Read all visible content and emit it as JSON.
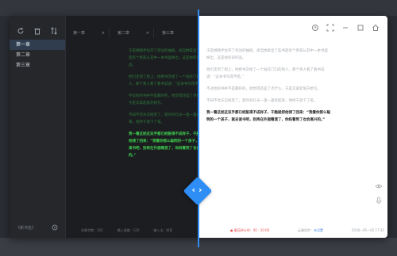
{
  "sidebar": {
    "chapters": [
      "第一章",
      "第二章",
      "第三章"
    ],
    "footer_label": "《新书名》",
    "icons": [
      "refresh-icon",
      "trash-icon",
      "sort-icon"
    ]
  },
  "dark": {
    "tabs": [
      "第一章",
      "第二章",
      "第三章"
    ],
    "paragraphs": [
      "于是她随手拉开了旁边的抽屉，再当她拿出了些书后有个男孩从其中一本书里掉出，这是他的旧作品。",
      "他们走到了街上，他把书交给了一个站在门口的男人，那个男人看了看书说道：“这本书写得不错。”",
      "不过他的书并不是最好的，他觉得还差了点什么，于是又拿起笔开始写。",
      "不知不觉天已经黑了，窗外的灯光一盏一盏亮起来，他终于放下了笔。"
    ],
    "highlight": "我一看这娃这双手都已经脏得不成样子，干脆就把他领了回来：“我看你那么聪明的一个孩子，就去读书吧，别再在外面瞎混了，你妈看到了也会高兴的。”",
    "status": [
      "本章字数：102",
      "输入速度：120",
      "输入法：拼音"
    ]
  },
  "light": {
    "paragraphs": [
      "于是她随手拉开了旁边的抽屉，再当她拿出了些书后有个男孩从其中一本书里掉出，这是他的旧作品。",
      "他们走到了街上，他把书交给了一个站在门口的男人，那个男人看了看书说道：“这本书写得不错。”",
      "不过他的书并不是最好的，他觉得还差了点什么，于是又拿起笔开始写。",
      "不知不觉天已经黑了，窗外的灯光一盏一盏亮起来，他终于放下了笔。"
    ],
    "highlight": "我一看这娃这双手都已经脏得不成样子，干脆就把他领了回来：“我看你那么聪明的一个孩子，就去读书吧，别再在外面瞎混了，你妈看到了也会高兴的。”",
    "status_left": "● 番茄钟计时：00 : 20:00",
    "status_mid": "云端同步：",
    "status_mid_link": "未设置",
    "status_right": "2018—05—02 17:32"
  },
  "colors": {
    "accent": "#2e8ef5",
    "dark_bg": "#1c1d20",
    "dark_text_green": "#3fd04f"
  }
}
